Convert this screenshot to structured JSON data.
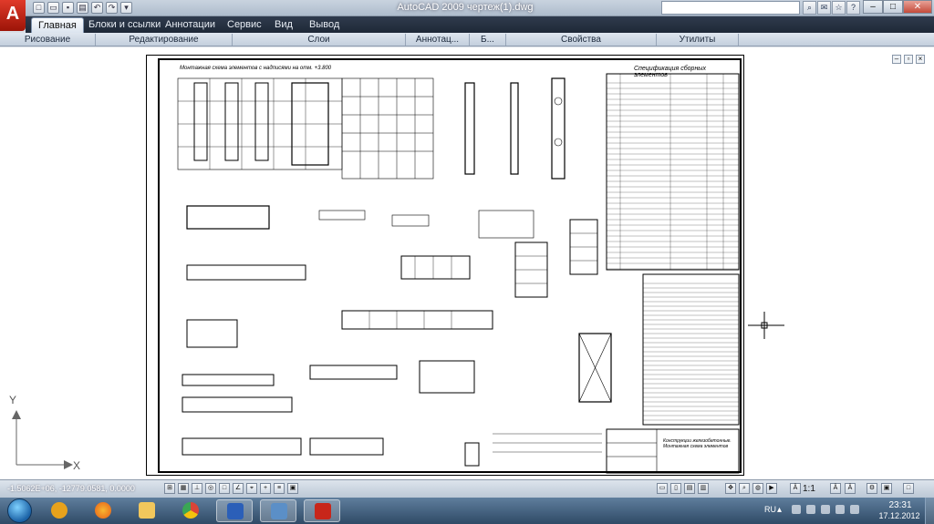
{
  "app": {
    "logo_letter": "A",
    "window_title": "AutoCAD 2009  чертеж(1).dwg"
  },
  "ribbon": {
    "tabs": [
      {
        "label": "Главная",
        "active": true
      },
      {
        "label": "Блоки и ссылки",
        "active": false
      },
      {
        "label": "Аннотации",
        "active": false
      },
      {
        "label": "Сервис",
        "active": false
      },
      {
        "label": "Вид",
        "active": false
      },
      {
        "label": "Вывод",
        "active": false
      }
    ],
    "panels": [
      "Рисование",
      "Редактирование",
      "Слои",
      "Аннотац...",
      "Б...",
      "Свойства",
      "Утилиты"
    ]
  },
  "drawing": {
    "title": "Монтажная схема элементов с надписями на отм. +3.800",
    "spec_title": "Спецификация сборных элементов",
    "stamp_text": "Конструкции железобетонные. Монтажная схема элементов"
  },
  "ucs": {
    "x_label": "X",
    "y_label": "Y"
  },
  "status": {
    "coordinates": "-1.5062E+06, -12779.0581, 0.0000",
    "scale": "1:1"
  },
  "taskbar": {
    "language": "RU",
    "time": "23:31",
    "date": "17.12.2012",
    "apps": [
      {
        "name": "winamp",
        "color": "#e8a21c"
      },
      {
        "name": "firefox",
        "color": "#e85d17"
      },
      {
        "name": "explorer",
        "color": "#f2c75c"
      },
      {
        "name": "chrome",
        "color": "#3aa655"
      },
      {
        "name": "word",
        "color": "#2b5fb8"
      },
      {
        "name": "picture-viewer",
        "color": "#5b8fc7"
      },
      {
        "name": "autocad",
        "color": "#c8261a"
      }
    ]
  },
  "colors": {
    "ribbon_tab_bg": "#1e2837",
    "taskbar_bg": "#2f4a66",
    "autocad_red": "#c8261a"
  }
}
